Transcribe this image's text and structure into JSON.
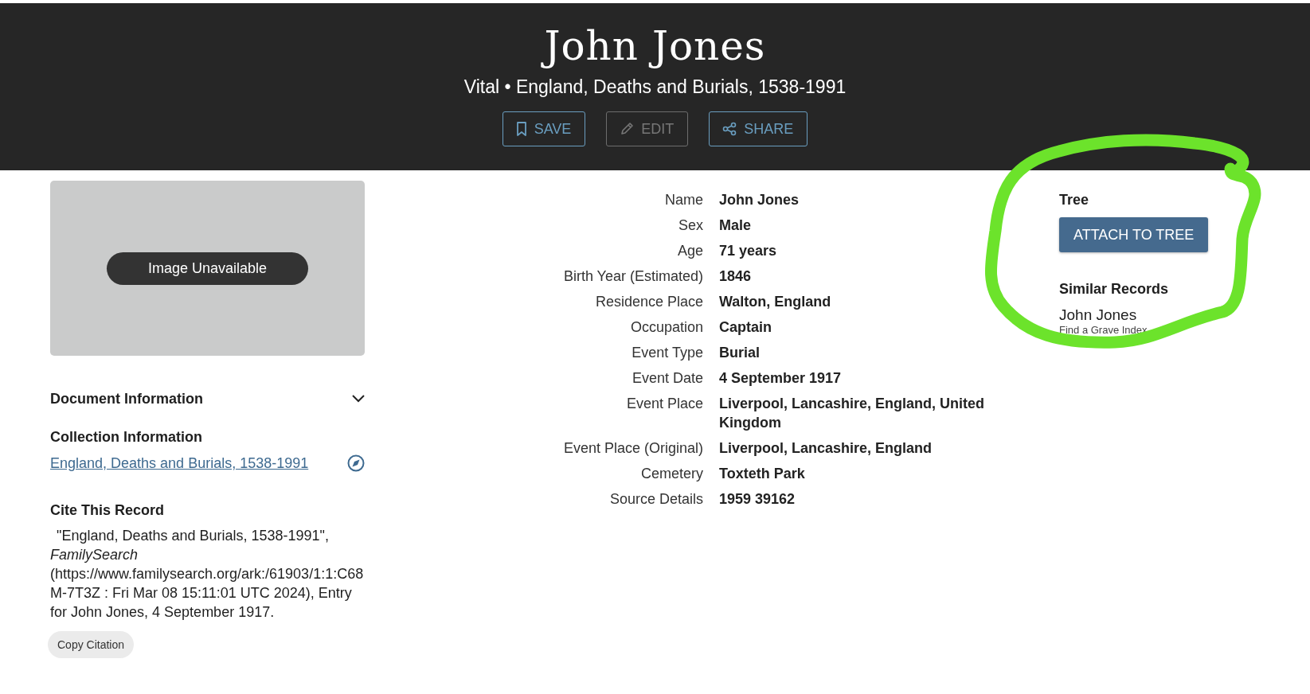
{
  "header": {
    "title": "John Jones",
    "subtitle": "Vital • England, Deaths and Burials, 1538-1991",
    "actions": [
      {
        "label": "SAVE",
        "kind": "save",
        "disabled": false
      },
      {
        "label": "EDIT",
        "kind": "edit",
        "disabled": true
      },
      {
        "label": "SHARE",
        "kind": "share",
        "disabled": false
      }
    ]
  },
  "image_panel": {
    "label": "Image Unavailable"
  },
  "document_information": {
    "title": "Document Information",
    "expanded": false
  },
  "collection_information": {
    "title": "Collection Information",
    "link": "England, Deaths and Burials, 1538-1991"
  },
  "citation": {
    "title": "Cite This Record",
    "text": "\"England, Deaths and Burials, 1538-1991\", *FamilySearch* (https://www.familysearch.org/ark:/61903/1:1:C68M-7T3Z : Fri Mar 08 15:11:01 UTC 2024), Entry for John Jones, 4 September 1917.",
    "button": "Copy Citation"
  },
  "facts": [
    {
      "label": "Name",
      "value": "John Jones"
    },
    {
      "label": "Sex",
      "value": "Male"
    },
    {
      "label": "Age",
      "value": "71 years"
    },
    {
      "label": "Birth Year (Estimated)",
      "value": "1846"
    },
    {
      "label": "Residence Place",
      "value": "Walton, England"
    },
    {
      "label": "Occupation",
      "value": "Captain"
    },
    {
      "label": "Event Type",
      "value": "Burial"
    },
    {
      "label": "Event Date",
      "value": "4 September 1917"
    },
    {
      "label": "Event Place",
      "value": "Liverpool, Lancashire, England, United Kingdom"
    },
    {
      "label": "Event Place (Original)",
      "value": "Liverpool, Lancashire, England"
    },
    {
      "label": "Cemetery",
      "value": "Toxteth Park"
    },
    {
      "label": "Source Details",
      "value": "1959 39162"
    }
  ],
  "tree": {
    "title": "Tree",
    "button": "ATTACH TO TREE"
  },
  "similar_records": {
    "title": "Similar Records",
    "items": [
      {
        "name": "John Jones",
        "source": "Find a Grave Index"
      }
    ]
  },
  "annotation": {
    "kind": "freehand-circle"
  }
}
